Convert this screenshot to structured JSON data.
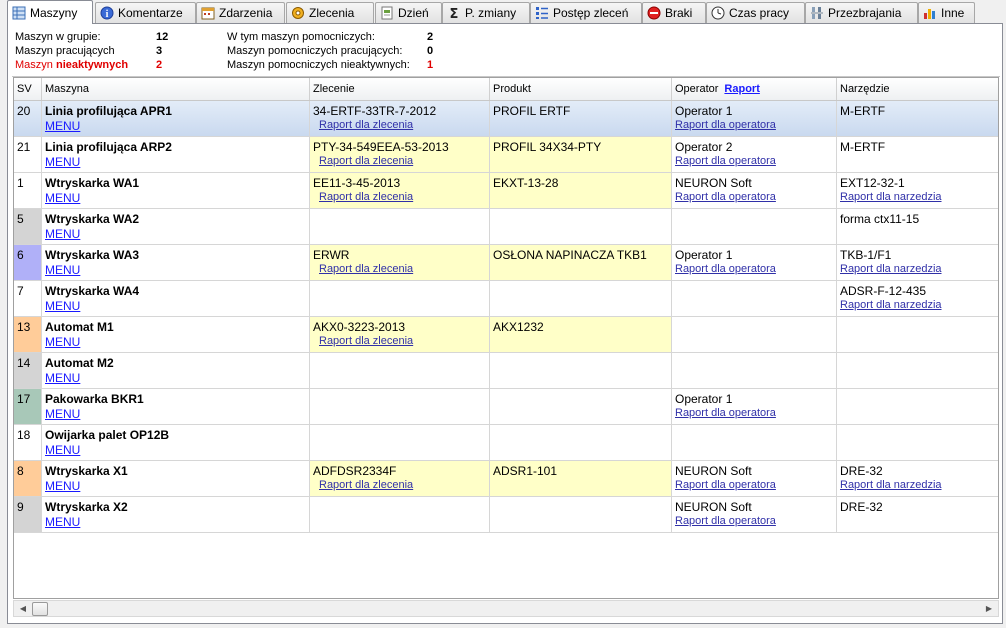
{
  "tabs": [
    {
      "label": "Maszyny",
      "icon": "grid-icon",
      "active": true
    },
    {
      "label": "Komentarze",
      "icon": "info-icon"
    },
    {
      "label": "Zdarzenia",
      "icon": "calendar-icon"
    },
    {
      "label": "Zlecenia",
      "icon": "gear-icon"
    },
    {
      "label": "Dzień",
      "icon": "document-icon"
    },
    {
      "label": "P. zmiany",
      "icon": "sigma-icon"
    },
    {
      "label": "Postęp zleceń",
      "icon": "list-icon"
    },
    {
      "label": "Braki",
      "icon": "stop-icon"
    },
    {
      "label": "Czas pracy",
      "icon": "clock-icon"
    },
    {
      "label": "Przezbrajania",
      "icon": "tools-icon"
    },
    {
      "label": "Inne",
      "icon": "chart-icon"
    }
  ],
  "summary": {
    "groups_label": "Maszyn w grupie:",
    "groups_value": "12",
    "working_label": "Maszyn pracujących",
    "working_value": "3",
    "inactive_label_prefix": "Maszyn",
    "inactive_label_red": "nieaktywnych",
    "inactive_value": "2",
    "aux_label": "W tym maszyn pomocniczych:",
    "aux_value": "2",
    "aux_working_label": "Maszyn pomocniczych pracujących:",
    "aux_working_value": "0",
    "aux_inactive_label": "Maszyn pomocniczych nieaktywnych:",
    "aux_inactive_value": "1"
  },
  "columns": {
    "sv": "SV",
    "machine": "Maszyna",
    "order": "Zlecenie",
    "product": "Produkt",
    "operator": "Operator",
    "operator_link": "Raport",
    "tool": "Narzędzie"
  },
  "labels": {
    "menu": "MENU",
    "order_report": "Raport dla zlecenia",
    "operator_report": "Raport dla operatora",
    "tool_report": "Raport dla narzedzia"
  },
  "colors": {
    "sv_gray": "#d4d4d4",
    "sv_blue": "#b0b0f8",
    "sv_orange": "#ffcc99",
    "sv_green": "#a8c8b8",
    "order_highlight": "#ffffc8",
    "selected_row": "#c9d9ef"
  },
  "rows": [
    {
      "sv": "20",
      "sv_color": "",
      "selected": true,
      "machine": "Linia profilująca APR1",
      "order": "34-ERTF-33TR-7-2012",
      "product": "PROFIL ERTF",
      "operator": "Operator 1",
      "tool": "M-ERTF",
      "tool_report": false,
      "highlight": false
    },
    {
      "sv": "21",
      "sv_color": "",
      "machine": "Linia profilująca ARP2",
      "order": "PTY-34-549EEA-53-2013",
      "product": "PROFIL 34X34-PTY",
      "operator": "Operator 2",
      "tool": "M-ERTF",
      "tool_report": false,
      "highlight": true
    },
    {
      "sv": "1",
      "sv_color": "",
      "machine": "Wtryskarka WA1",
      "order": "EE11-3-45-2013",
      "product": "EKXT-13-28",
      "operator": "NEURON Soft",
      "tool": "EXT12-32-1",
      "tool_report": true,
      "highlight": true
    },
    {
      "sv": "5",
      "sv_color": "gray",
      "machine": "Wtryskarka WA2",
      "order": "",
      "product": "",
      "operator": "",
      "tool": "forma ctx11-15",
      "tool_report": false,
      "highlight": false
    },
    {
      "sv": "6",
      "sv_color": "blue",
      "machine": "Wtryskarka WA3",
      "order": "ERWR",
      "product": "OSŁONA NAPINACZA TKB1",
      "operator": "Operator 1",
      "tool": "TKB-1/F1",
      "tool_report": true,
      "highlight": true
    },
    {
      "sv": "7",
      "sv_color": "",
      "machine": "Wtryskarka WA4",
      "order": "",
      "product": "",
      "operator": "",
      "tool": "ADSR-F-12-435",
      "tool_report": true,
      "highlight": false
    },
    {
      "sv": "13",
      "sv_color": "orange",
      "machine": "Automat M1",
      "order": "AKX0-3223-2013",
      "product": "AKX1232",
      "operator": "",
      "tool": "",
      "tool_report": false,
      "highlight": true
    },
    {
      "sv": "14",
      "sv_color": "gray",
      "machine": "Automat M2",
      "order": "",
      "product": "",
      "operator": "",
      "tool": "",
      "tool_report": false,
      "highlight": false
    },
    {
      "sv": "17",
      "sv_color": "green",
      "machine": "Pakowarka BKR1",
      "order": "",
      "product": "",
      "operator": "Operator 1",
      "tool": "",
      "tool_report": false,
      "highlight": false
    },
    {
      "sv": "18",
      "sv_color": "",
      "machine": "Owijarka palet OP12B",
      "order": "",
      "product": "",
      "operator": "",
      "tool": "",
      "tool_report": false,
      "highlight": false
    },
    {
      "sv": "8",
      "sv_color": "orange",
      "machine": "Wtryskarka X1",
      "order": "ADFDSR2334F",
      "product": "ADSR1-101",
      "operator": "NEURON Soft",
      "tool": "DRE-32",
      "tool_report": true,
      "highlight": true
    },
    {
      "sv": "9",
      "sv_color": "gray",
      "machine": "Wtryskarka X2",
      "order": "",
      "product": "",
      "operator": "NEURON Soft",
      "tool": "DRE-32",
      "tool_report": false,
      "highlight": false
    }
  ]
}
